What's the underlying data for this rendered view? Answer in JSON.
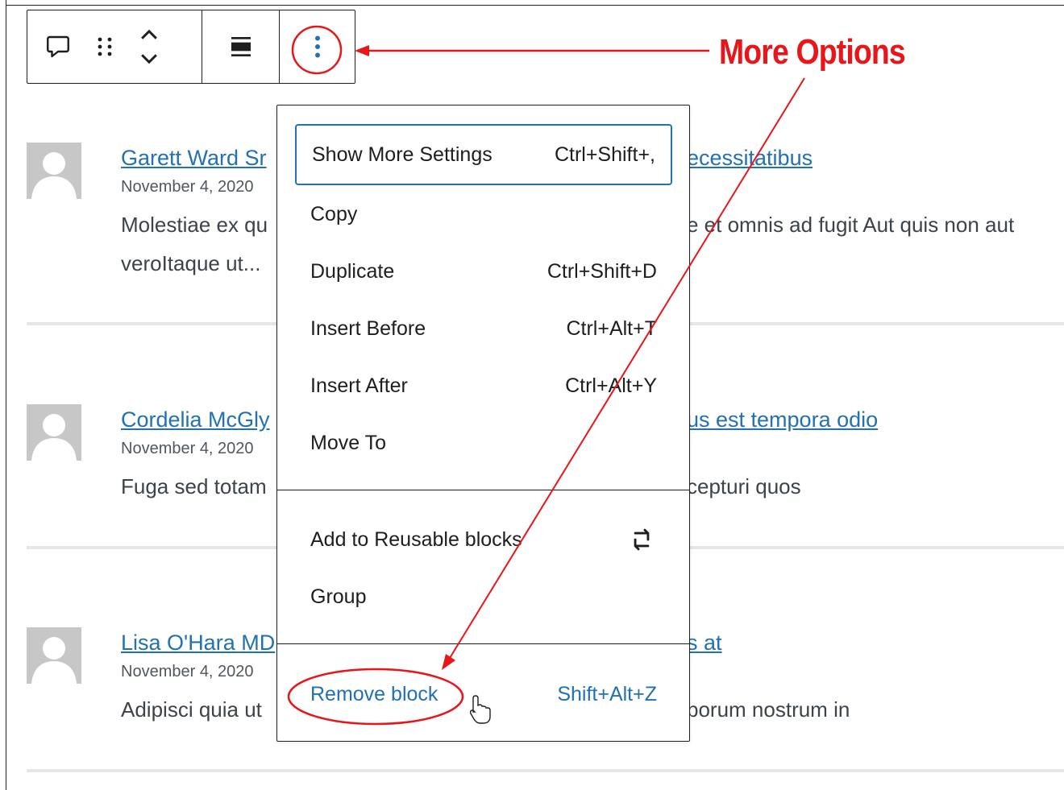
{
  "toolbar": {
    "icons": [
      "comment-icon",
      "drag-handle-icon",
      "move-up-down-icon",
      "align-icon",
      "more-options-icon"
    ]
  },
  "comments": [
    {
      "author": "Garett Ward Sr",
      "title_tail": "ecessitatibus",
      "date": "November 4, 2020",
      "excerpt_line1": "Molestiae ex qu",
      "excerpt_line1_tail": "e et omnis ad fugit Aut quis non aut",
      "excerpt_line2": "veroItaque ut..."
    },
    {
      "author": "Cordelia McGly",
      "title_tail": "us est tempora odio",
      "date": "November 4, 2020",
      "excerpt_line1": "Fuga sed totam",
      "excerpt_line1_tail": "cepturi quos"
    },
    {
      "author": "Lisa O'Hara MD",
      "title_tail": "s at",
      "date": "November 4, 2020",
      "excerpt_line1": "Adipisci quia ut",
      "excerpt_line1_tail": "borum nostrum in"
    }
  ],
  "menu": {
    "show_more_settings": {
      "label": "Show More Settings",
      "shortcut": "Ctrl+Shift+,"
    },
    "copy": {
      "label": "Copy"
    },
    "duplicate": {
      "label": "Duplicate",
      "shortcut": "Ctrl+Shift+D"
    },
    "insert_before": {
      "label": "Insert Before",
      "shortcut": "Ctrl+Alt+T"
    },
    "insert_after": {
      "label": "Insert After",
      "shortcut": "Ctrl+Alt+Y"
    },
    "move_to": {
      "label": "Move To"
    },
    "add_reusable": {
      "label": "Add to Reusable blocks",
      "icon": "reusable-block-icon"
    },
    "group": {
      "label": "Group"
    },
    "remove_block": {
      "label": "Remove block",
      "shortcut": "Shift+Alt+Z"
    }
  },
  "annotation": {
    "label": "More Options",
    "color": "#e8151a"
  },
  "colors": {
    "link": "#2271b1",
    "annotation": "#e8151a",
    "avatar": "#c7c7c7"
  }
}
